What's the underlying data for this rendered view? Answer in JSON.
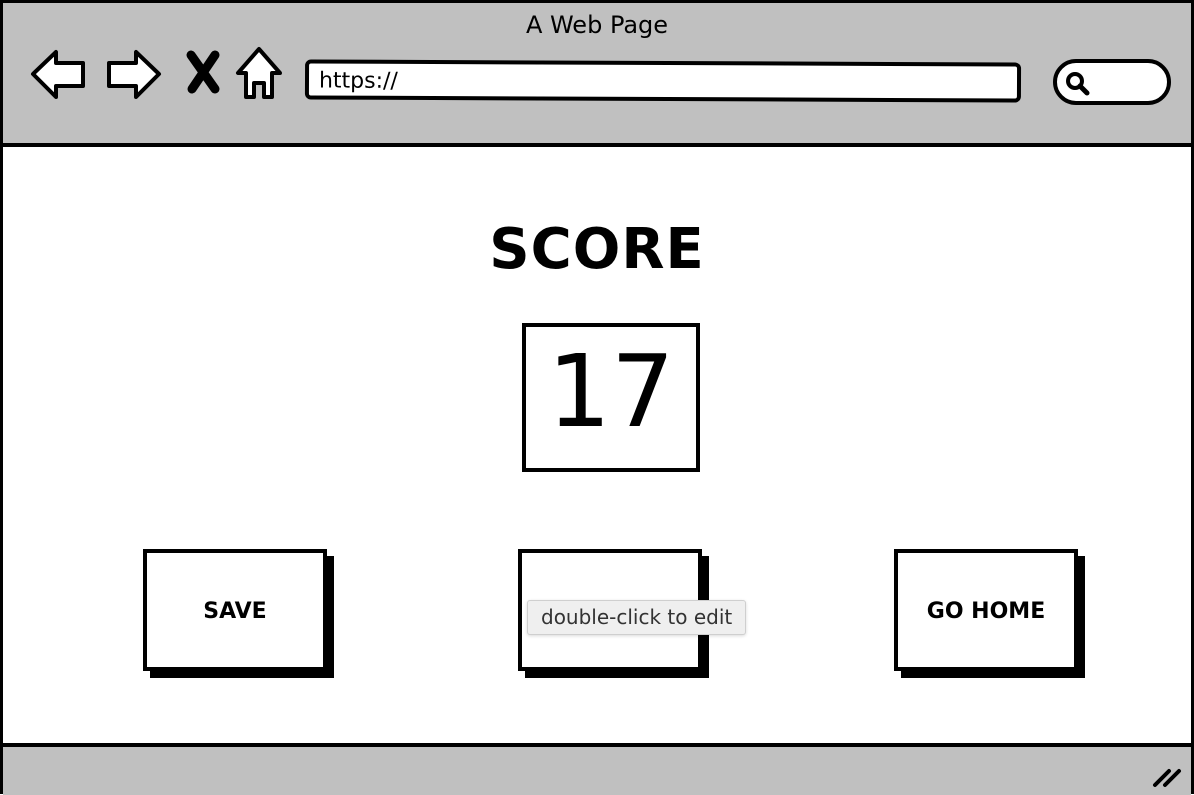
{
  "window": {
    "title": "A Web Page"
  },
  "toolbar": {
    "icons": [
      "back-arrow-icon",
      "forward-arrow-icon",
      "close-x-icon",
      "home-icon",
      "search-icon"
    ],
    "url": "https://"
  },
  "main": {
    "score_label": "SCORE",
    "score_value": "17",
    "buttons": [
      {
        "label": "SAVE"
      },
      {
        "label": ""
      },
      {
        "label": "GO HOME"
      }
    ]
  },
  "tooltip": {
    "text": "double-click to edit"
  },
  "colors": {
    "chrome": "#c0c0c0",
    "ink": "#000000",
    "page": "#ffffff",
    "tooltip_bg": "#efefef"
  }
}
